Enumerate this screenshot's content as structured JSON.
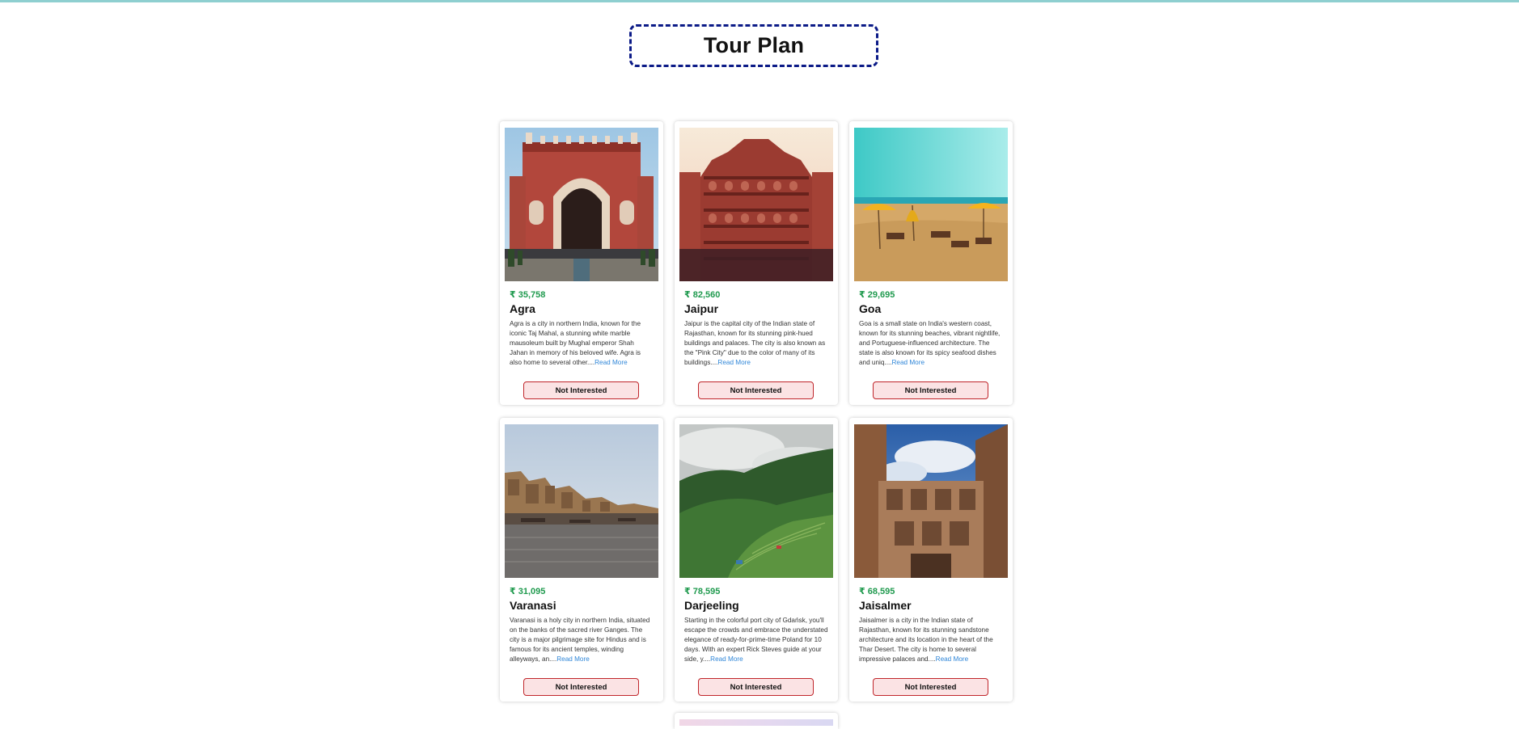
{
  "page": {
    "title": "Tour Plan"
  },
  "tours": [
    {
      "price": "₹ 35,758",
      "name": "Agra",
      "description": "Agra is a city in northern India, known for the iconic Taj Mahal, a stunning white marble mausoleum built by Mughal emperor Shah Jahan in memory of his beloved wife. Agra is also home to several other....",
      "read_more": "Read More",
      "button": "Not Interested",
      "image": "agra-gate-photo"
    },
    {
      "price": "₹ 82,560",
      "name": "Jaipur",
      "description": "Jaipur is the capital city of the Indian state of Rajasthan, known for its stunning pink-hued buildings and palaces. The city is also known as the \"Pink City\" due to the color of many of its buildings....",
      "read_more": "Read More",
      "button": "Not Interested",
      "image": "hawa-mahal-photo"
    },
    {
      "price": "₹ 29,695",
      "name": "Goa",
      "description": "Goa is a small state on India's western coast, known for its stunning beaches, vibrant nightlife, and Portuguese-influenced architecture. The state is also known for its spicy seafood dishes and uniq....",
      "read_more": "Read More",
      "button": "Not Interested",
      "image": "goa-beach-photo"
    },
    {
      "price": "₹ 31,095",
      "name": "Varanasi",
      "description": "Varanasi is a holy city in northern India, situated on the banks of the sacred river Ganges. The city is a major pilgrimage site for Hindus and is famous for its ancient temples, winding alleyways, an....",
      "read_more": "Read More",
      "button": "Not Interested",
      "image": "varanasi-ghats-photo"
    },
    {
      "price": "₹ 78,595",
      "name": "Darjeeling",
      "description": "Starting in the colorful port city of Gdańsk, you'll escape the crowds and embrace the understated elegance of ready-for-prime-time Poland for 10 days. With an expert Rick Steves guide at your side, y....",
      "read_more": "Read More",
      "button": "Not Interested",
      "image": "darjeeling-hills-photo"
    },
    {
      "price": "₹ 68,595",
      "name": "Jaisalmer",
      "description": "Jaisalmer is a city in the Indian state of Rajasthan, known for its stunning sandstone architecture and its location in the heart of the Thar Desert. The city is home to several impressive palaces and....",
      "read_more": "Read More",
      "button": "Not Interested",
      "image": "jaisalmer-haveli-photo"
    }
  ],
  "colors": {
    "price": "#1f9a4e",
    "link": "#2f86d8",
    "button_border": "#c0262b",
    "button_bg": "#fbe3e4",
    "title_border": "#0b1a87"
  }
}
